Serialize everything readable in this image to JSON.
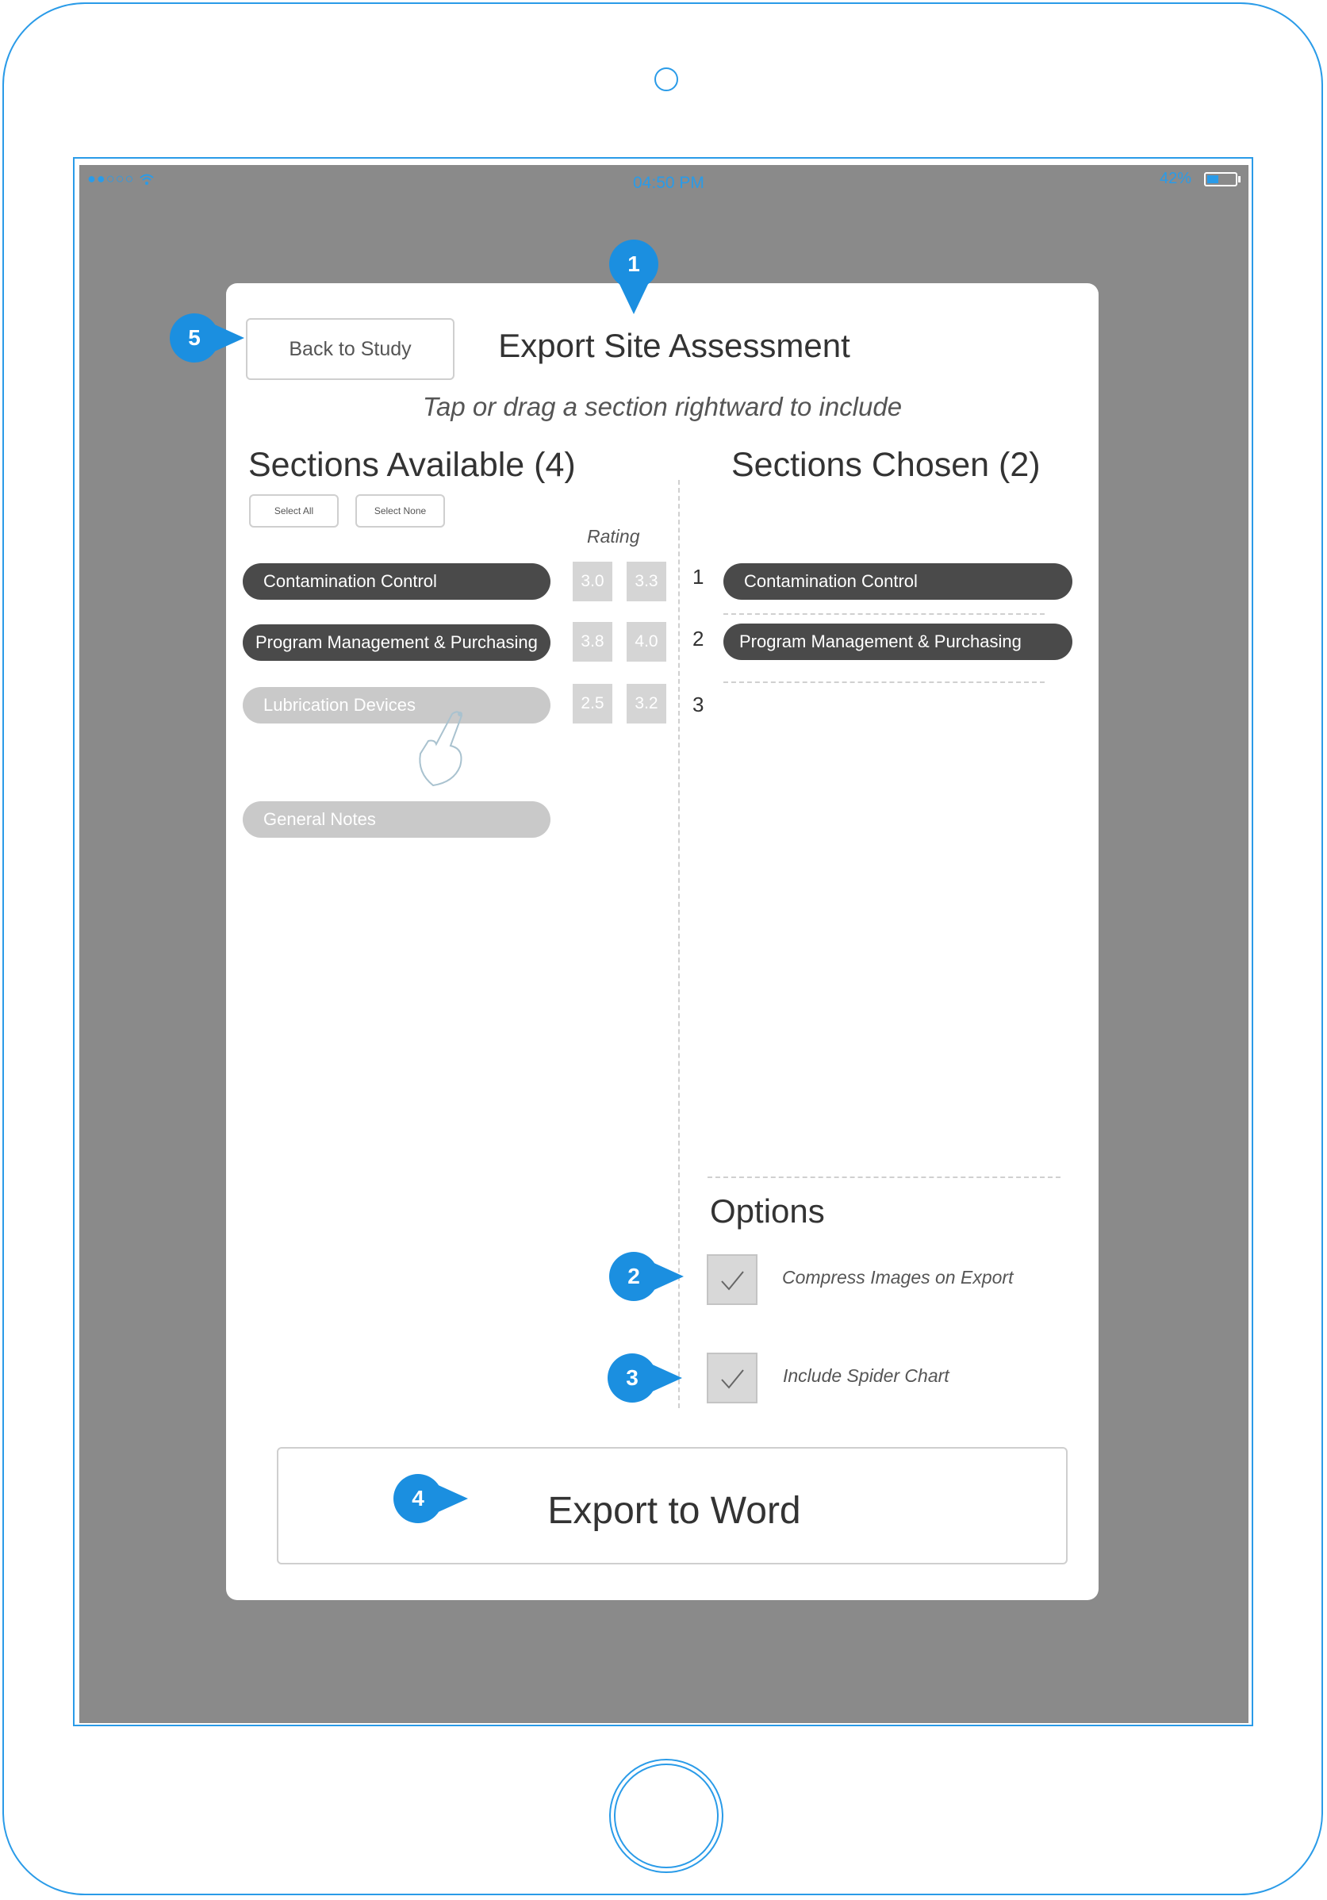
{
  "status_bar": {
    "signal": "●●○○○",
    "wifi_icon": "wifi-icon",
    "time": "04:50 PM",
    "battery_pct": "42%",
    "battery_level": 0.42
  },
  "dialog": {
    "title": "Export Site Assessment",
    "subtitle": "Tap or drag a section rightward to include",
    "back_label": "Back to Study"
  },
  "available": {
    "heading": "Sections Available (4)",
    "select_all": "Select All",
    "select_none": "Select None",
    "rating_header": "Rating",
    "items": [
      {
        "label": "Contamination Control",
        "rating_a": "3.0",
        "rating_b": "3.3",
        "chosen": true
      },
      {
        "label": "Program Management & Purchasing",
        "rating_a": "3.8",
        "rating_b": "4.0",
        "chosen": true
      },
      {
        "label": "Lubrication Devices",
        "rating_a": "2.5",
        "rating_b": "3.2",
        "chosen": false
      },
      {
        "label": "General Notes",
        "chosen": false
      }
    ]
  },
  "chosen": {
    "heading": "Sections Chosen (2)",
    "slots": [
      {
        "number": "1",
        "label": "Contamination Control"
      },
      {
        "number": "2",
        "label": "Program Management & Purchasing"
      },
      {
        "number": "3"
      }
    ]
  },
  "options": {
    "heading": "Options",
    "items": [
      {
        "label": "Compress Images on Export",
        "checked": true
      },
      {
        "label": "Include Spider Chart",
        "checked": true
      }
    ]
  },
  "export": {
    "label": "Export to Word"
  },
  "callouts": [
    "1",
    "2",
    "3",
    "4",
    "5"
  ],
  "colors": {
    "accent": "#2a9be8",
    "backdrop": "#8a8a8a",
    "dark_pill": "#4a4a4a",
    "light_pill": "#c9c9c9"
  }
}
